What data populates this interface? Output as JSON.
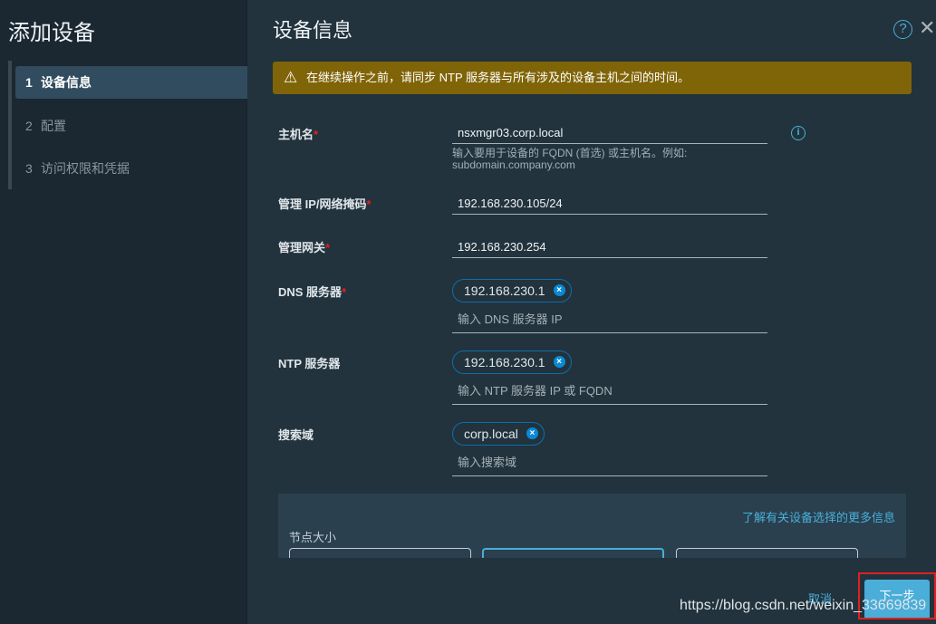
{
  "sidebar": {
    "title": "添加设备",
    "steps": [
      {
        "num": "1",
        "label": "设备信息"
      },
      {
        "num": "2",
        "label": "配置"
      },
      {
        "num": "3",
        "label": "访问权限和凭据"
      }
    ]
  },
  "main": {
    "title": "设备信息",
    "warning": "在继续操作之前，请同步 NTP 服务器与所有涉及的设备主机之间的时间。",
    "fields": {
      "hostname": {
        "label": "主机名",
        "value": "nsxmgr03.corp.local",
        "hint": "输入要用于设备的 FQDN (首选) 或主机名。例如: subdomain.company.com"
      },
      "mgmt_ip": {
        "label": "管理 IP/网络掩码",
        "value": "192.168.230.105/24"
      },
      "gateway": {
        "label": "管理网关",
        "value": "192.168.230.254"
      },
      "dns": {
        "label": "DNS 服务器",
        "chip": "192.168.230.1",
        "placeholder": "输入 DNS 服务器 IP"
      },
      "ntp": {
        "label": "NTP 服务器",
        "chip": "192.168.230.1",
        "placeholder": "输入 NTP 服务器 IP 或 FQDN"
      },
      "search": {
        "label": "搜索域",
        "chip": "corp.local",
        "placeholder": "输入搜索域"
      }
    },
    "required_mark": "*",
    "more_info_link": "了解有关设备选择的更多信息",
    "node_size_label": "节点大小"
  },
  "footer": {
    "cancel": "取消",
    "next": "下一步"
  },
  "watermark": "https://blog.csdn.net/weixin_33669839",
  "colors": {
    "accent": "#49afd9",
    "warning": "#806408",
    "required": "#e02020"
  }
}
